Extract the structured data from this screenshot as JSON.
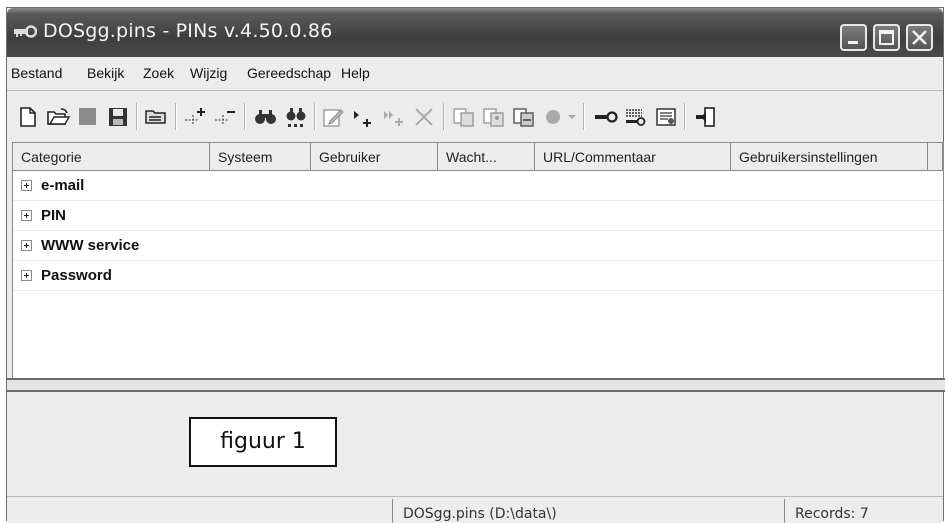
{
  "window": {
    "title": "DOSgg.pins - PINs v.4.50.0.86"
  },
  "menu": [
    "Bestand",
    "Bekijk",
    "Zoek",
    "Wijzig",
    "Gereedschap",
    "Help"
  ],
  "columns": [
    "Categorie",
    "Systeem",
    "Gebruiker",
    "Wacht...",
    "URL/Commentaar",
    "Gebruikersinstellingen"
  ],
  "rows": [
    "e-mail",
    "PIN",
    "WWW service",
    "Password"
  ],
  "caption": "figuur 1",
  "status": {
    "file": "DOSgg.pins (D:\\data\\)",
    "records": "Records: 7"
  },
  "icons": {
    "toolbar": [
      "new-file-icon",
      "open-folder-icon",
      "stop-icon",
      "save-icon",
      "import-icon",
      "add-row-icon",
      "remove-row-icon",
      "find-icon",
      "find-next-icon",
      "edit-icon",
      "add-item-icon",
      "add-subitem-icon",
      "delete-icon",
      "copy-icon",
      "copy-user-icon",
      "copy-password-icon",
      "record-icon",
      "key-icon",
      "password-generator-icon",
      "settings-icon",
      "exit-icon"
    ]
  }
}
